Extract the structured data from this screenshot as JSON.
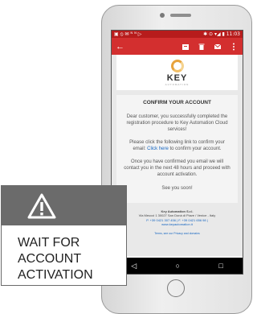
{
  "status_bar": {
    "left_icons": "▣ ⦸ ✉ ᴺ ᴺ ▷",
    "right": "✱ ⊙ ▾◢ ▮ 11:03"
  },
  "app_bar": {
    "back_icon": "←"
  },
  "email": {
    "logo_text": "KEY",
    "logo_sub": "AUTOMATION",
    "heading": "CONFIRM YOUR ACCOUNT",
    "para1": "Dear customer, you successfully completed the registration procedure to Key Automation Cloud services!",
    "para2_before": "Please ",
    "para2_link": "click the following link",
    "para2_after": " to confirm your email: ",
    "para2_link2": "Click here",
    "para2_end": " to confirm your account.",
    "para3": "Once you have confirmed you email we will contact you in the next 48 hours and proceed with account activation.",
    "para4": "See you soon!",
    "footer_name": "Key Automation S.r.l.",
    "footer_address": "Via Meucci 1 30027 San Donà di Piave / Venice - Italy",
    "footer_phone": "P. +39 0421 307 456 | F. +39 0421 656 98 |",
    "footer_web": "www.keyautomation.it",
    "terms": "Terms, see our Privacy and domains"
  },
  "nav": {
    "back": "◁",
    "home": "○",
    "recents": "□"
  },
  "warning": {
    "line1": "WAIT FOR",
    "line2": "ACCOUNT",
    "line3": "ACTIVATION"
  }
}
